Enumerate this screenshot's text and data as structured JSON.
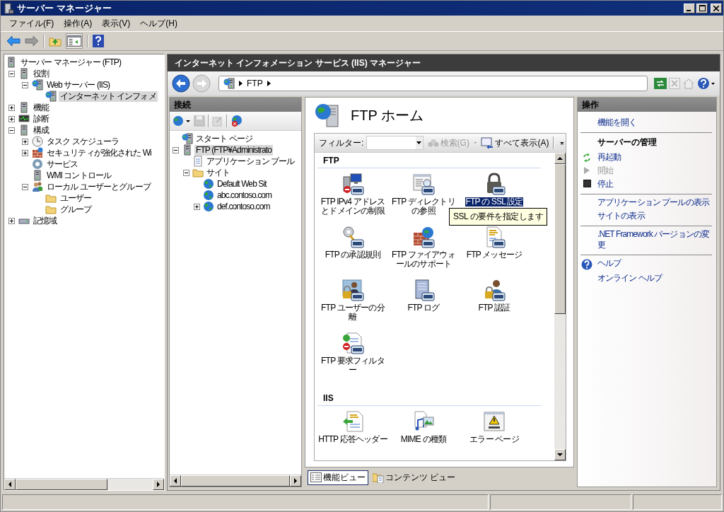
{
  "window": {
    "title": "サーバー マネージャー"
  },
  "menu": [
    "ファイル(F)",
    "操作(A)",
    "表示(V)",
    "ヘルプ(H)"
  ],
  "server_tree": [
    {
      "label": "サーバー マネージャー (FTP)",
      "kind": "server",
      "selected": false,
      "children": [
        {
          "label": "役割",
          "kind": "roles",
          "expanded": true,
          "selected": false,
          "children": [
            {
              "label": "Web サーバー (IIS)",
              "kind": "web-server",
              "expanded": true,
              "selected": false,
              "children": [
                {
                  "label": "インターネット インフォメ",
                  "kind": "iis",
                  "selected": true
                }
              ]
            }
          ]
        },
        {
          "label": "機能",
          "kind": "features",
          "expanded": false,
          "selected": false
        },
        {
          "label": "診断",
          "kind": "diagnostics",
          "expanded": false,
          "selected": false
        },
        {
          "label": "構成",
          "kind": "configuration",
          "expanded": true,
          "selected": false,
          "children": [
            {
              "label": "タスク スケジューラ",
              "kind": "scheduler",
              "expanded": false,
              "selected": false
            },
            {
              "label": "セキュリティが強化された Wi",
              "kind": "firewall",
              "expanded": false,
              "selected": false
            },
            {
              "label": "サービス",
              "kind": "services",
              "selected": false
            },
            {
              "label": "WMI コントロール",
              "kind": "wmi",
              "selected": false
            },
            {
              "label": "ローカル ユーザーとグループ",
              "kind": "users",
              "expanded": true,
              "selected": false,
              "children": [
                {
                  "label": "ユーザー",
                  "kind": "folder",
                  "selected": false
                },
                {
                  "label": "グループ",
                  "kind": "folder",
                  "selected": false
                }
              ]
            }
          ]
        },
        {
          "label": "記憶域",
          "kind": "storage",
          "expanded": false,
          "selected": false
        }
      ]
    }
  ],
  "iis": {
    "title": "インターネット インフォメーション サービス (IIS) マネージャー",
    "breadcrumb": [
      "FTP"
    ]
  },
  "connections": {
    "title": "接続",
    "tree": [
      {
        "label": "スタート ページ",
        "kind": "start-page",
        "selected": false
      },
      {
        "label": "FTP (FTP¥Administrato",
        "kind": "server",
        "expanded": true,
        "selected": true,
        "children": [
          {
            "label": "アプリケーション プール",
            "kind": "app-pools",
            "selected": false
          },
          {
            "label": "サイト",
            "kind": "sites",
            "expanded": true,
            "selected": false,
            "children": [
              {
                "label": "Default Web Sit",
                "kind": "site",
                "selected": false
              },
              {
                "label": "abc.contoso.com",
                "kind": "site",
                "selected": false
              },
              {
                "label": "def.contoso.com",
                "kind": "site",
                "expanded": false,
                "selected": false
              }
            ]
          }
        ]
      }
    ]
  },
  "feature_view": {
    "title": "FTP ホーム",
    "filter": {
      "label": "フィルター:",
      "search": "検索(G)",
      "show_all": "すべて表示(A)"
    },
    "groups": [
      {
        "name": "FTP",
        "items": [
          {
            "label": "FTP IPv4 アドレスとドメインの制限",
            "kind": "ip-restrictions",
            "selected": false
          },
          {
            "label": "FTP ディレクトリの参照",
            "kind": "dir-browsing",
            "selected": false
          },
          {
            "label": "FTP の SSL 設定",
            "kind": "ssl",
            "selected": true,
            "tooltip": "SSL の要件を指定します"
          },
          {
            "label": "FTP の承認規則",
            "kind": "authorization",
            "selected": false
          },
          {
            "label": "FTP ファイアウォールのサポート",
            "kind": "firewall",
            "selected": false
          },
          {
            "label": "FTP メッセージ",
            "kind": "messages",
            "selected": false
          },
          {
            "label": "FTP ユーザーの分離",
            "kind": "user-isolation",
            "selected": false
          },
          {
            "label": "FTP ログ",
            "kind": "logging",
            "selected": false
          },
          {
            "label": "FTP 認証",
            "kind": "authentication",
            "selected": false
          },
          {
            "label": "FTP 要求フィルター",
            "kind": "request-filtering",
            "selected": false
          }
        ]
      },
      {
        "name": "IIS",
        "items": [
          {
            "label": "HTTP 応答ヘッダー",
            "kind": "http-headers",
            "selected": false
          },
          {
            "label": "MIME の種類",
            "kind": "mime",
            "selected": false
          },
          {
            "label": "エラー ページ",
            "kind": "error-pages",
            "selected": false
          }
        ]
      }
    ],
    "view_tabs": [
      {
        "label": "機能ビュー",
        "selected": true
      },
      {
        "label": "コンテンツ ビュー",
        "selected": false
      }
    ]
  },
  "actions": {
    "title": "操作",
    "sections": [
      {
        "items": [
          {
            "kind": "link",
            "label": "機能を開く",
            "disabled": false
          }
        ]
      },
      {
        "title": "サーバーの管理",
        "items": [
          {
            "kind": "restart",
            "label": "再起動",
            "disabled": false
          },
          {
            "kind": "start",
            "label": "開始",
            "disabled": true
          },
          {
            "kind": "stop",
            "label": "停止",
            "disabled": false
          }
        ]
      },
      {
        "items": [
          {
            "kind": "link",
            "label": "アプリケーション プールの表示",
            "disabled": false
          },
          {
            "kind": "link",
            "label": "サイトの表示",
            "disabled": false
          }
        ]
      },
      {
        "items": [
          {
            "kind": "link",
            "label": ".NET Framework バージョンの変更",
            "disabled": false
          }
        ]
      },
      {
        "items": [
          {
            "kind": "help",
            "label": "ヘルプ",
            "disabled": false
          },
          {
            "kind": "link",
            "label": "オンライン ヘルプ",
            "disabled": false
          }
        ]
      }
    ]
  }
}
